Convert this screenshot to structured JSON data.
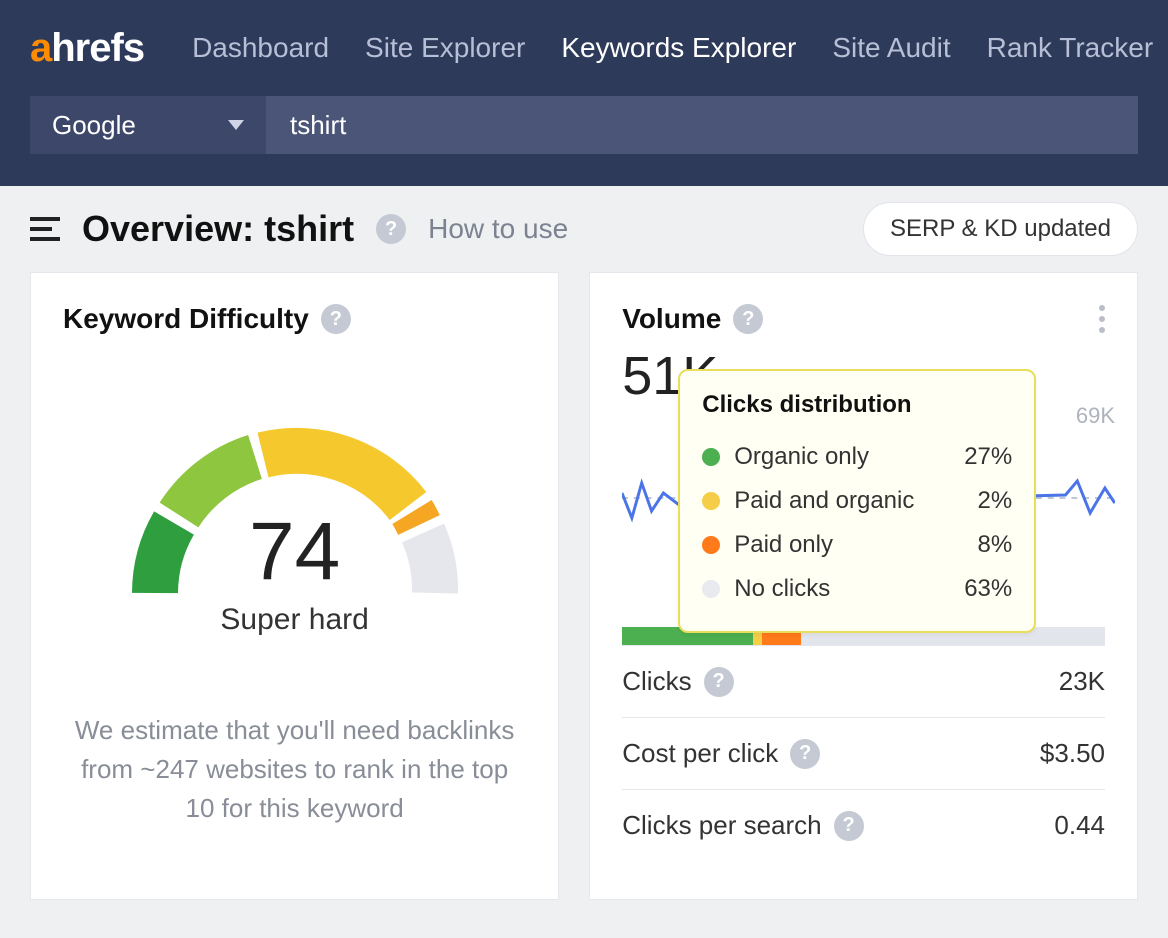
{
  "nav": {
    "items": [
      "Dashboard",
      "Site Explorer",
      "Keywords Explorer",
      "Site Audit",
      "Rank Tracker"
    ],
    "active": "Keywords Explorer"
  },
  "search": {
    "engine": "Google",
    "keyword": "tshirt"
  },
  "subheader": {
    "title": "Overview: tshirt",
    "howto": "How to use",
    "serp_btn": "SERP & KD updated"
  },
  "kd": {
    "heading": "Keyword Difficulty",
    "value": "74",
    "label": "Super hard",
    "note": "We estimate that you'll need backlinks from ~247 websites to rank in the top 10 for this keyword"
  },
  "volume": {
    "heading": "Volume",
    "value": "51K",
    "axis_top": "69K",
    "tooltip_title": "Clicks distribution",
    "dist": [
      {
        "label": "Organic only",
        "pct": "27%",
        "color": "green"
      },
      {
        "label": "Paid and organic",
        "pct": "2%",
        "color": "yellow"
      },
      {
        "label": "Paid only",
        "pct": "8%",
        "color": "orange"
      },
      {
        "label": "No clicks",
        "pct": "63%",
        "color": "grey"
      }
    ],
    "metrics": [
      {
        "label": "Clicks",
        "value": "23K"
      },
      {
        "label": "Cost per click",
        "value": "$3.50"
      },
      {
        "label": "Clicks per search",
        "value": "0.44"
      }
    ]
  },
  "chart_data": {
    "type": "gauge",
    "title": "Keyword Difficulty",
    "value": 74,
    "range": [
      0,
      100
    ],
    "label": "Super hard",
    "segments": [
      {
        "from": 0,
        "to": 25,
        "color": "#2e9e3f"
      },
      {
        "from": 25,
        "to": 50,
        "color": "#8fc63f"
      },
      {
        "from": 50,
        "to": 74,
        "color": "#f5c92e"
      },
      {
        "from": 74,
        "to": 78,
        "color": "#f5a623"
      },
      {
        "from": 78,
        "to": 100,
        "color": "#e5e7ed"
      }
    ]
  }
}
